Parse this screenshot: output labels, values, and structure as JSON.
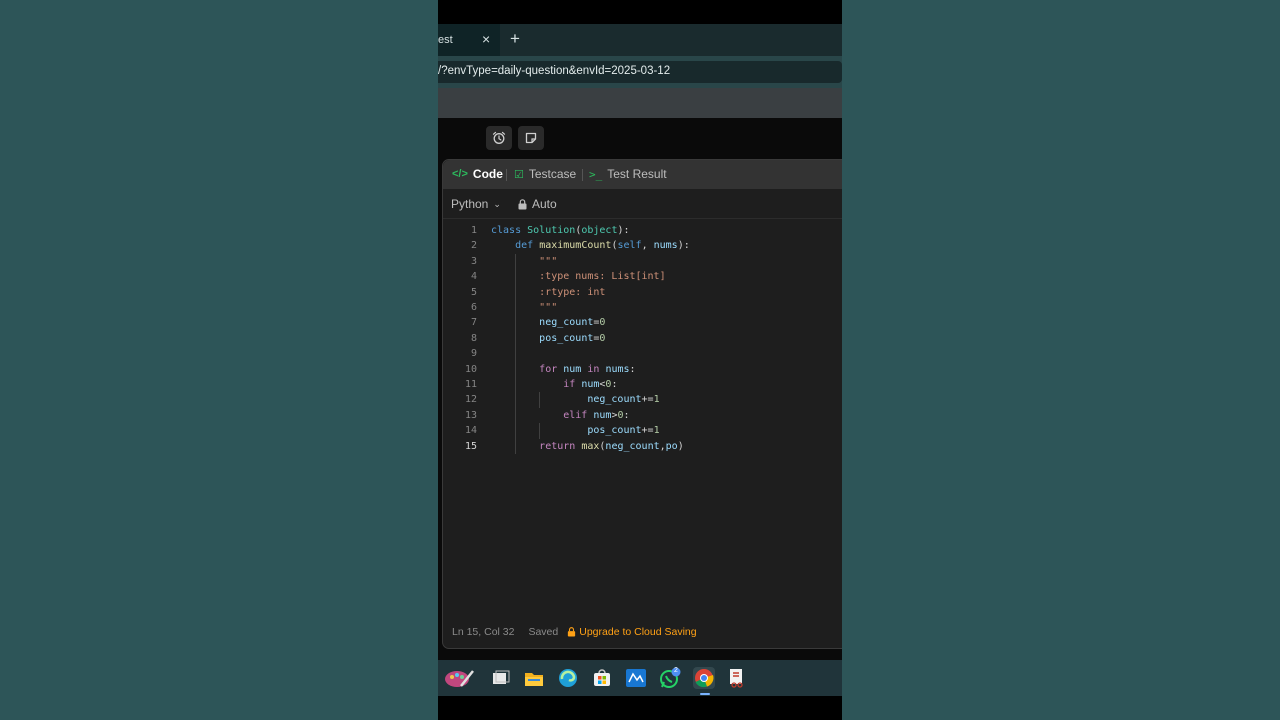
{
  "browser": {
    "tab_title": "est",
    "tab_close": "×",
    "new_tab": "+",
    "url": "/?envType=daily-question&envId=2025-03-12"
  },
  "editor": {
    "tabs": {
      "code": "Code",
      "testcase": "Testcase",
      "test_result": "Test Result"
    },
    "language": "Python",
    "mode": "Auto",
    "code_lines": [
      "class Solution(object):",
      "    def maximumCount(self, nums):",
      "        \"\"\"",
      "        :type nums: List[int]",
      "        :rtype: int",
      "        \"\"\"",
      "        neg_count=0",
      "        pos_count=0",
      "",
      "        for num in nums:",
      "            if num<0:",
      "                neg_count+=1",
      "            elif num>0:",
      "                pos_count+=1",
      "        return max(neg_count,po)"
    ],
    "line_numbers": [
      "1",
      "2",
      "3",
      "4",
      "5",
      "6",
      "7",
      "8",
      "9",
      "10",
      "11",
      "12",
      "13",
      "14",
      "15"
    ],
    "active_line": 15,
    "status": {
      "cursor": "Ln 15, Col 32",
      "saved": "Saved",
      "upgrade": "Upgrade to Cloud Saving"
    }
  },
  "taskbar": {
    "items": [
      "paint-icon",
      "task-view-icon",
      "file-explorer-icon",
      "edge-icon",
      "store-icon",
      "mdp-icon",
      "whatsapp-icon",
      "chrome-icon",
      "snipping-tool-icon"
    ],
    "whatsapp_badge": "2"
  },
  "colors": {
    "accent_green": "#2cbb5d",
    "upgrade_orange": "#ffa116",
    "background": "#2d5558"
  }
}
